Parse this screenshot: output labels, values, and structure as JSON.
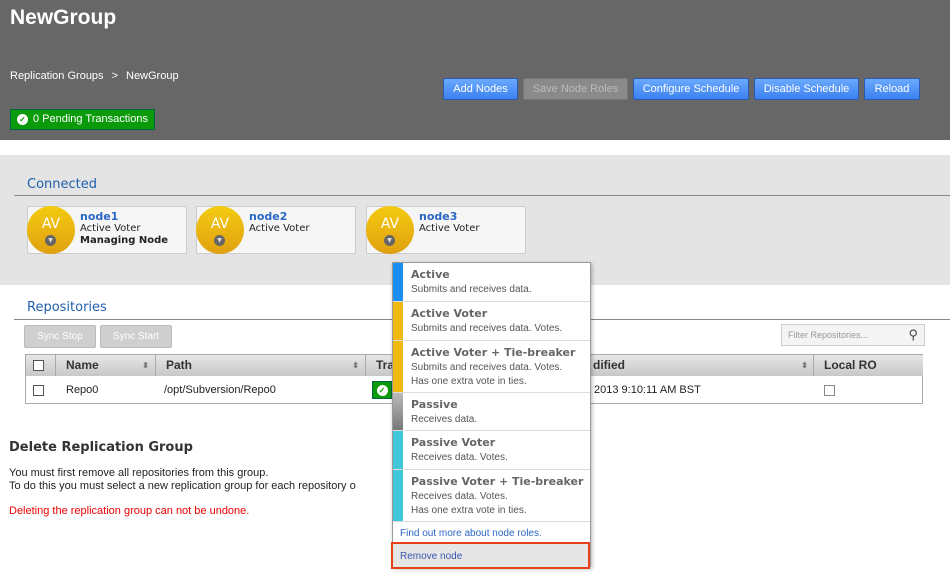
{
  "header": {
    "title": "NewGroup",
    "breadcrumb": [
      "Replication Groups",
      ">",
      "NewGroup"
    ],
    "pending": "0 Pending Transactions",
    "buttons": {
      "add_nodes": "Add Nodes",
      "save_roles": "Save Node Roles",
      "configure": "Configure Schedule",
      "disable": "Disable Schedule",
      "reload": "Reload"
    }
  },
  "connected": {
    "heading": "Connected",
    "nodes": [
      {
        "badge": "AV",
        "name": "node1",
        "role": "Active Voter",
        "extra": "Managing Node"
      },
      {
        "badge": "AV",
        "name": "node2",
        "role": "Active Voter"
      },
      {
        "badge": "AV",
        "name": "node3",
        "role": "Active Voter"
      }
    ]
  },
  "repositories": {
    "heading": "Repositories",
    "sync_stop": "Sync Stop",
    "sync_start": "Sync Start",
    "filter_placeholder": "Filter Repositories...",
    "columns": [
      "Name",
      "Path",
      "Tra",
      "dified",
      "Local RO"
    ],
    "rows": [
      {
        "name": "Repo0",
        "path": "/opt/Subversion/Repo0",
        "modified": "2013 9:10:11 AM BST"
      }
    ]
  },
  "delete": {
    "heading": "Delete Replication Group",
    "line1": "You must first remove all repositories from this group.",
    "line2": "To do this you must select a new replication group for each repository o",
    "warning": "Deleting the replication group can not be undone."
  },
  "role_menu": {
    "items": [
      {
        "title": "Active",
        "desc": "Submits and receives data.",
        "color": "#1a8ff0"
      },
      {
        "title": "Active Voter",
        "desc": "Submits and receives data. Votes.",
        "color": "#f0b810"
      },
      {
        "title": "Active Voter + Tie-breaker",
        "desc": "Submits and receives data. Votes.",
        "desc2": "Has one extra vote in ties.",
        "color": "#f0b810"
      },
      {
        "title": "Passive",
        "desc": "Receives data.",
        "color": "#909090"
      },
      {
        "title": "Passive Voter",
        "desc": "Receives data. Votes.",
        "color": "#40c8d8"
      },
      {
        "title": "Passive Voter + Tie-breaker",
        "desc": "Receives data. Votes.",
        "desc2": "Has one extra vote in ties.",
        "color": "#40c8d8"
      }
    ],
    "learn_more": "Find out more about node roles.",
    "remove": "Remove node"
  }
}
